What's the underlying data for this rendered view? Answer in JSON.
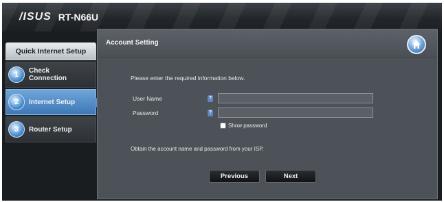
{
  "header": {
    "brand": "/ISUS",
    "model": "RT-N66U"
  },
  "sidebar": {
    "title": "Quick Internet Setup",
    "steps": [
      {
        "number": "1",
        "label_line1": "Check",
        "label_line2": "Connection",
        "active": false
      },
      {
        "number": "2",
        "label_line1": "Internet Setup",
        "label_line2": "",
        "active": true
      },
      {
        "number": "3",
        "label_line1": "Router Setup",
        "label_line2": "",
        "active": false
      }
    ]
  },
  "panel": {
    "title": "Account Setting",
    "intro": "Please enter the required information below.",
    "fields": {
      "username": {
        "label": "User Name",
        "help": "?",
        "value": ""
      },
      "password": {
        "label": "Password",
        "help": "?",
        "value": ""
      }
    },
    "show_password_label": "Show password",
    "note": "Obtain the account name and password from your ISP.",
    "buttons": {
      "previous": "Previous",
      "next": "Next"
    }
  },
  "icons": {
    "home": "home-icon",
    "help": "help-icon",
    "step": "step-number-icon"
  },
  "colors": {
    "accent": "#4a8fd0",
    "panel": "#4c5257",
    "background": "#1a1d20"
  }
}
